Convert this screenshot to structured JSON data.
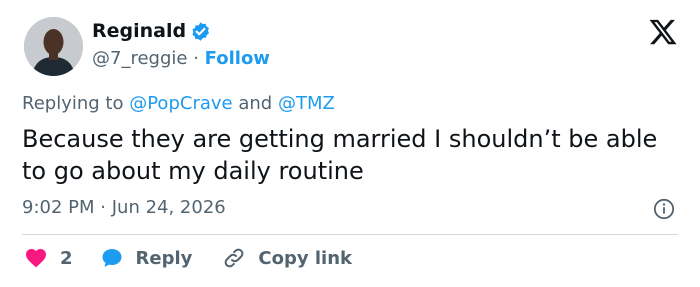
{
  "user": {
    "name": "Reginald",
    "handle": "@7_reggie",
    "separator": "·",
    "follow_label": "Follow"
  },
  "reply_context": {
    "prefix": "Replying to",
    "mention1": "@PopCrave",
    "conjunction": "and",
    "mention2": "@TMZ"
  },
  "tweet": {
    "text": "Because they are getting married I shouldn’t be able to go about my daily routine",
    "time": "9:02 PM",
    "separator": "·",
    "date": "Jun 24, 2026"
  },
  "actions": {
    "like_count": "2",
    "reply_label": "Reply",
    "copy_label": "Copy link"
  },
  "colors": {
    "accent": "#1d9bf0",
    "like": "#f91880",
    "muted": "#536471"
  },
  "icons": [
    "verified-badge-icon",
    "x-logo-icon",
    "info-icon",
    "heart-icon",
    "reply-bubble-icon",
    "link-icon"
  ]
}
